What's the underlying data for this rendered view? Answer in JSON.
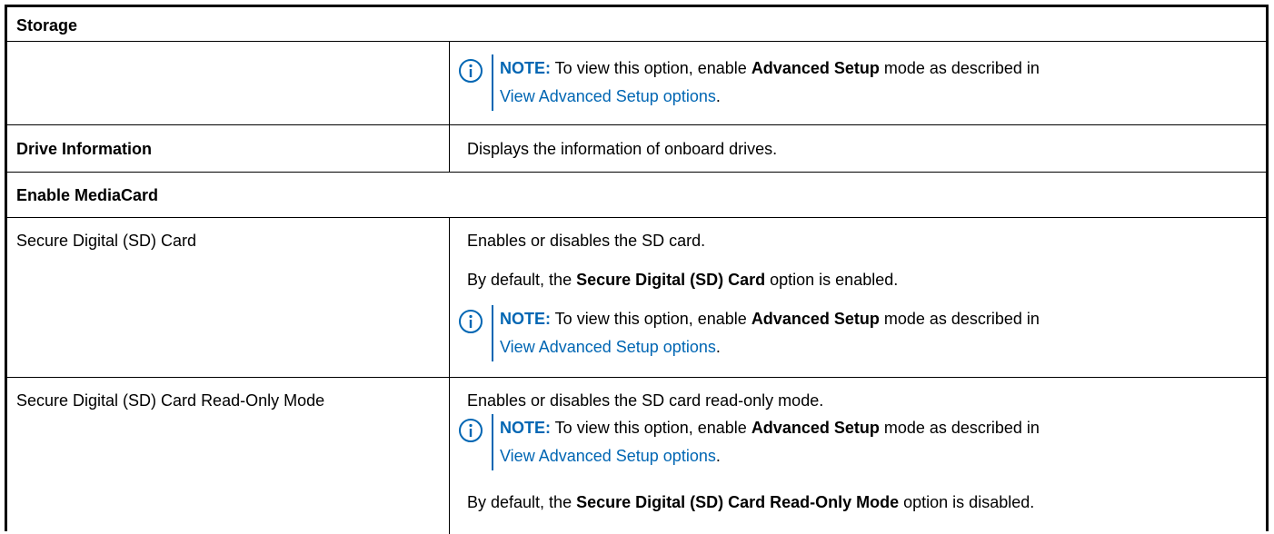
{
  "table": {
    "header": "Storage",
    "rows": {
      "note_row": {
        "note": {
          "label": "NOTE:",
          "pre": " To view this option, enable ",
          "strong": "Advanced Setup",
          "post": " mode as described in",
          "link": "View Advanced Setup options",
          "end": "."
        }
      },
      "drive_information": {
        "setting": "Drive Information",
        "description": "Displays the information of onboard drives."
      },
      "enable_mediacard": {
        "setting": "Enable MediaCard"
      },
      "sd_card": {
        "setting": "Secure Digital (SD) Card",
        "description": "Enables or disables the SD card.",
        "default": {
          "pre": "By default, the ",
          "strong": "Secure Digital (SD) Card",
          "post": " option is enabled."
        },
        "note": {
          "label": "NOTE:",
          "pre": " To view this option, enable ",
          "strong": "Advanced Setup",
          "post": " mode as described in",
          "link": "View Advanced Setup options",
          "end": "."
        }
      },
      "sd_read_only": {
        "setting": "Secure Digital (SD) Card Read-Only Mode",
        "description": "Enables or disables the SD card read-only mode.",
        "note": {
          "label": "NOTE:",
          "pre": " To view this option, enable ",
          "strong": "Advanced Setup",
          "post": " mode as described in",
          "link": "View Advanced Setup options",
          "end": "."
        },
        "default": {
          "pre": "By default, the ",
          "strong": "Secure Digital (SD) Card Read-Only Mode",
          "post": " option is disabled."
        }
      }
    }
  },
  "icons": {
    "note": "info-circle-icon"
  },
  "colors": {
    "accent": "#0066b3",
    "border": "#000000"
  }
}
